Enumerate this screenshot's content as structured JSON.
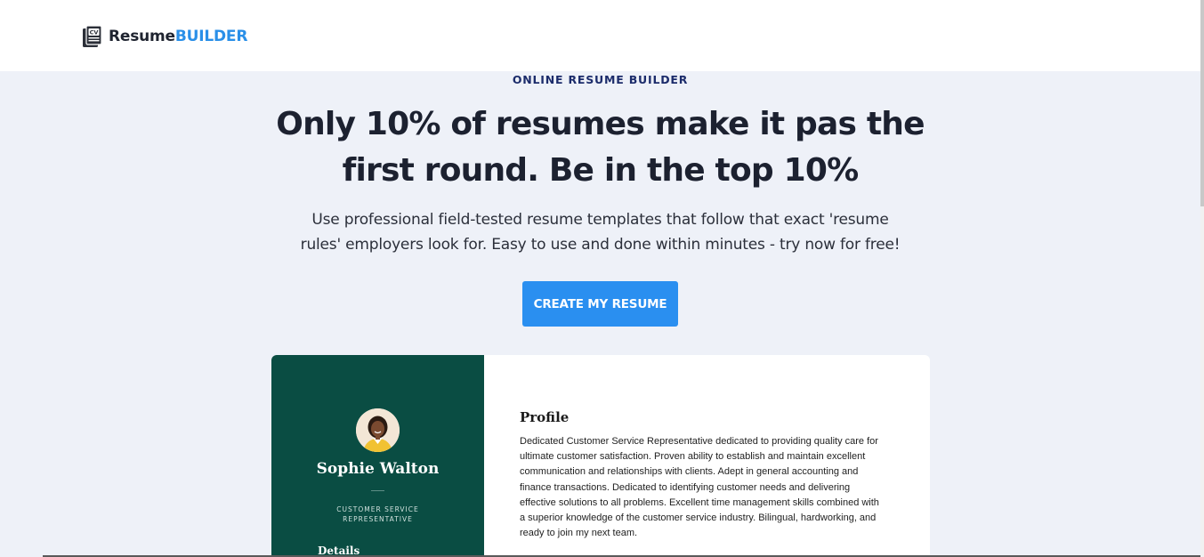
{
  "brand": {
    "name_part1": "Resume",
    "name_part2": "BUILDER",
    "icon": "cv-document-icon",
    "accent_color": "#2a8fe8"
  },
  "hero": {
    "eyebrow": "ONLINE RESUME BUILDER",
    "headline_line1": "Only 10% of resumes make it pas the",
    "headline_line2": "first round. Be in the top 10%",
    "subhead_line1": "Use professional field-tested resume templates that follow that exact 'resume",
    "subhead_line2": "rules' employers look for. Easy to use and done within minutes - try now for free!",
    "cta_label": "CREATE MY RESUME",
    "cta_color": "#2a8ff0"
  },
  "resume_preview": {
    "sidebar_color": "#0a4d43",
    "name": "Sophie Walton",
    "job_title_line1": "CUSTOMER SERVICE",
    "job_title_line2": "REPRESENTATIVE",
    "sidebar_heading": "Details",
    "profile_heading": "Profile",
    "profile_lines": [
      "Dedicated Customer Service Representative dedicated to providing quality care for",
      "ultimate customer satisfaction. Proven ability to establish and maintain excellent",
      "communication and relationships with clients. Adept in general accounting and",
      "finance transactions. Dedicated to identifying customer needs and delivering",
      "effective solutions to all problems. Excellent time management skills combined with",
      "a superior knowledge of the customer service industry. Bilingual, hardworking, and",
      "ready to join my next team."
    ]
  }
}
